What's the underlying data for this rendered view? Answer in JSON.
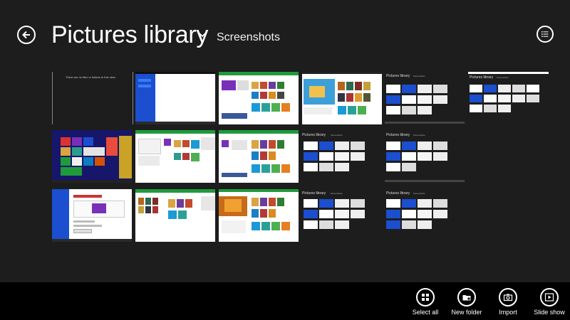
{
  "header": {
    "title": "Pictures library",
    "subtitle": "Screenshots"
  },
  "thumbnails": [
    {
      "caption": "There are no files or folders in this view."
    },
    {
      "caption": ""
    },
    {
      "caption": ""
    },
    {
      "caption": ""
    },
    {
      "caption": "Pictures library",
      "sub": "Screenshots"
    },
    {
      "caption": "Pictures library",
      "sub": "Screenshots"
    },
    {
      "caption": ""
    },
    {
      "caption": ""
    },
    {
      "caption": ""
    },
    {
      "caption": "Pictures library",
      "sub": "Screenshots"
    },
    {
      "caption": "Pictures library",
      "sub": "Screenshots"
    },
    {
      "caption": ""
    },
    {
      "caption": ""
    },
    {
      "caption": ""
    },
    {
      "caption": "Pictures library",
      "sub": "Screenshots"
    },
    {
      "caption": "Pictures library",
      "sub": "Screenshots"
    }
  ],
  "app_bar": {
    "select_all": "Select all",
    "new_folder": "New folder",
    "import": "Import",
    "slide_show": "Slide show"
  },
  "icons": {
    "back": "back-arrow-icon",
    "view_list": "list-view-icon",
    "select_all": "grid-icon",
    "new_folder": "folder-add-icon",
    "import": "camera-import-icon",
    "slide_show": "play-icon"
  },
  "colors": {
    "background": "#1d1d1d",
    "app_bar": "#000000",
    "store_green": "#1f9b3c",
    "start_blue": "#1b4fd0",
    "accent_purple": "#7a2fb8"
  }
}
